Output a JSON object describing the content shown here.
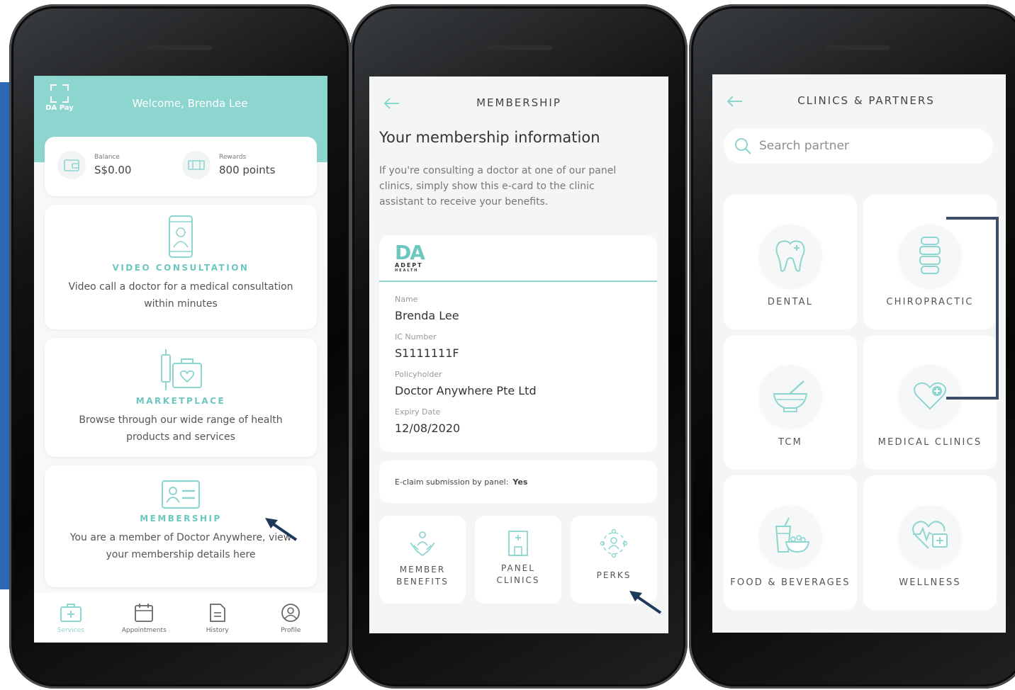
{
  "screen1": {
    "dapay_label": "DA Pay",
    "welcome": "Welcome, Brenda Lee",
    "balance_label": "Balance",
    "balance_value": "S$0.00",
    "rewards_label": "Rewards",
    "rewards_value": "800 points",
    "services": [
      {
        "title": "VIDEO CONSULTATION",
        "desc": "Video call a doctor for a medical consultation within minutes",
        "icon": "phone-doctor-icon"
      },
      {
        "title": "MARKETPLACE",
        "desc": "Browse through our wide range of health products and services",
        "icon": "medical-kit-icon"
      },
      {
        "title": "MEMBERSHIP",
        "desc": "You are a member of Doctor Anywhere, view your membership details here",
        "icon": "id-card-icon"
      }
    ],
    "tabs": [
      {
        "label": "Services",
        "icon": "medical-bag-icon",
        "active": true
      },
      {
        "label": "Appointments",
        "icon": "calendar-icon",
        "active": false
      },
      {
        "label": "History",
        "icon": "document-icon",
        "active": false
      },
      {
        "label": "Profile",
        "icon": "user-circle-icon",
        "active": false
      }
    ]
  },
  "screen2": {
    "nav_title": "MEMBERSHIP",
    "heading": "Your membership information",
    "intro": "If you're consulting a doctor at one of our panel clinics, simply show this e-card to the clinic assistant to receive your benefits.",
    "logo_text": "DA",
    "logo_sub": "ADEPT",
    "logo_sub2": "HEALTH",
    "fields": [
      {
        "label": "Name",
        "value": "Brenda Lee"
      },
      {
        "label": "IC Number",
        "value": "S1111111F"
      },
      {
        "label": "Policyholder",
        "value": "Doctor Anywhere Pte Ltd"
      },
      {
        "label": "Expiry Date",
        "value": "12/08/2020"
      }
    ],
    "eclaim_label": "E-claim submission by panel:",
    "eclaim_value": "Yes",
    "benefits": [
      {
        "label": "MEMBER BENEFITS",
        "icon": "hands-person-icon"
      },
      {
        "label": "PANEL CLINICS",
        "icon": "clinic-building-icon"
      },
      {
        "label": "PERKS",
        "icon": "network-people-icon"
      }
    ]
  },
  "screen3": {
    "nav_title": "CLINICS & PARTNERS",
    "search_placeholder": "Search partner",
    "categories": [
      {
        "label": "DENTAL",
        "icon": "tooth-icon"
      },
      {
        "label": "CHIROPRACTIC",
        "icon": "spine-icon"
      },
      {
        "label": "TCM",
        "icon": "mortar-pestle-icon"
      },
      {
        "label": "MEDICAL CLINICS",
        "icon": "heart-plus-icon"
      },
      {
        "label": "FOOD & BEVERAGES",
        "icon": "food-drink-icon"
      },
      {
        "label": "WELLNESS",
        "icon": "heart-pulse-icon"
      }
    ]
  },
  "colors": {
    "teal": "#8dd5cf",
    "teal_text": "#6cc7bf",
    "accent_blue": "#2e67b5",
    "arrow_navy": "#1d3a5c",
    "bracket": "#3d4d68"
  }
}
